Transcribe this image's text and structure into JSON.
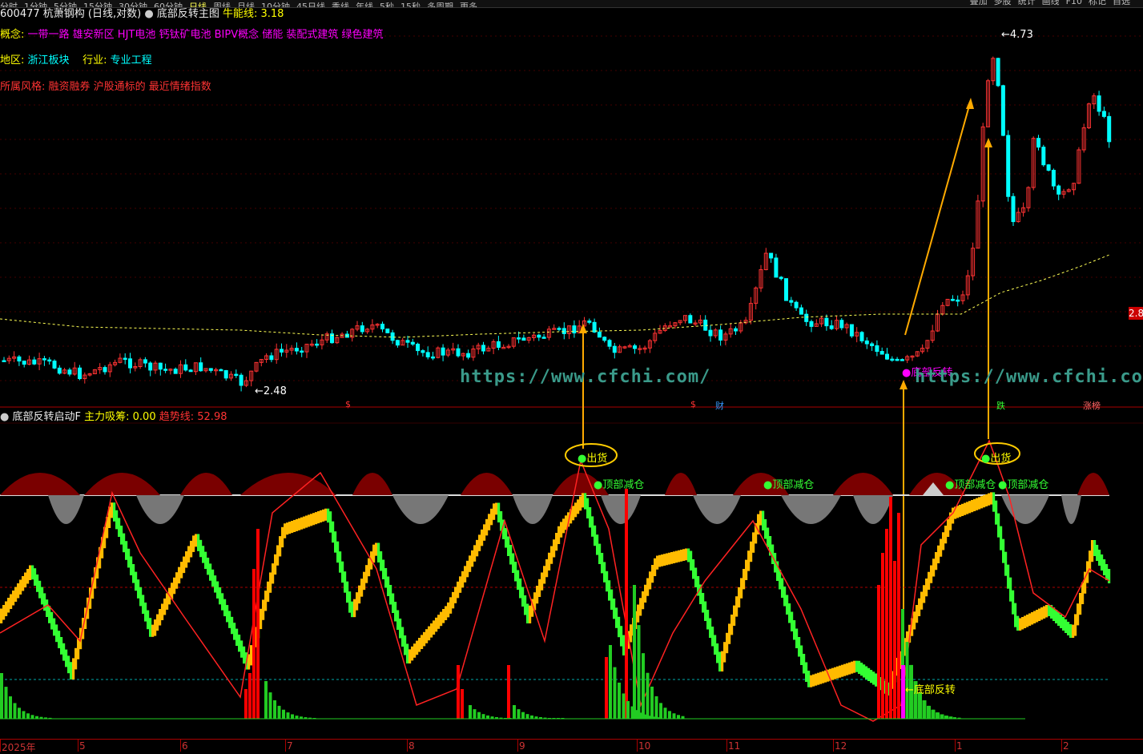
{
  "topbar": {
    "items": [
      "分时",
      "1分钟",
      "5分钟",
      "15分钟",
      "30分钟",
      "60分钟",
      "日线",
      "周线",
      "月线",
      "10分钟",
      "45日线",
      "季线",
      "年线",
      "5秒",
      "15秒",
      "多周期",
      "更多"
    ],
    "active": "日线",
    "right_items": [
      "叠加",
      "多股",
      "统计",
      "画线",
      "F10",
      "标记",
      "自选"
    ]
  },
  "header": {
    "code_name": "600477 杭萧钢构",
    "period": "(日线,对数)",
    "indicator": "底部反转主图",
    "line_label": "牛能线:",
    "line_value": "3.18"
  },
  "info": {
    "concept_label": "概念:",
    "concepts": "一带一路 雄安新区 HJT电池 钙钛矿电池 BIPV概念 储能 装配式建筑 绿色建筑",
    "region_label": "地区:",
    "region": "浙江板块",
    "industry_label": "行业:",
    "industry": "专业工程",
    "style_label": "所属风格:",
    "styles": "融资融券 沪股通标的 最近情绪指数"
  },
  "price_labels": {
    "high": "4.73",
    "low": "2.48",
    "current": "2.8"
  },
  "signals": {
    "bottom_reversal_main": "底部反转",
    "sell": "出货",
    "top_reduce": "顶部减仓",
    "bottom_reversal_ind": "底部反转"
  },
  "events": [
    "$",
    "$",
    "财",
    "跌",
    "涨榜"
  ],
  "indicator_panel": {
    "name": "底部反转启动F",
    "main_label": "主力吸筹:",
    "main_value": "0.00",
    "trend_label": "趋势线:",
    "trend_value": "52.98"
  },
  "watermark": "https://www.cfchi.com/",
  "date_axis": [
    "2025年",
    "5",
    "6",
    "7",
    "8",
    "9",
    "10",
    "11",
    "12",
    "1",
    "2"
  ],
  "colors": {
    "up": "#ff3333",
    "down": "#00ffff",
    "ma": "#ffff55",
    "arrow": "#ffaa00",
    "green": "#33ff33",
    "gold": "#ffbb00"
  }
}
